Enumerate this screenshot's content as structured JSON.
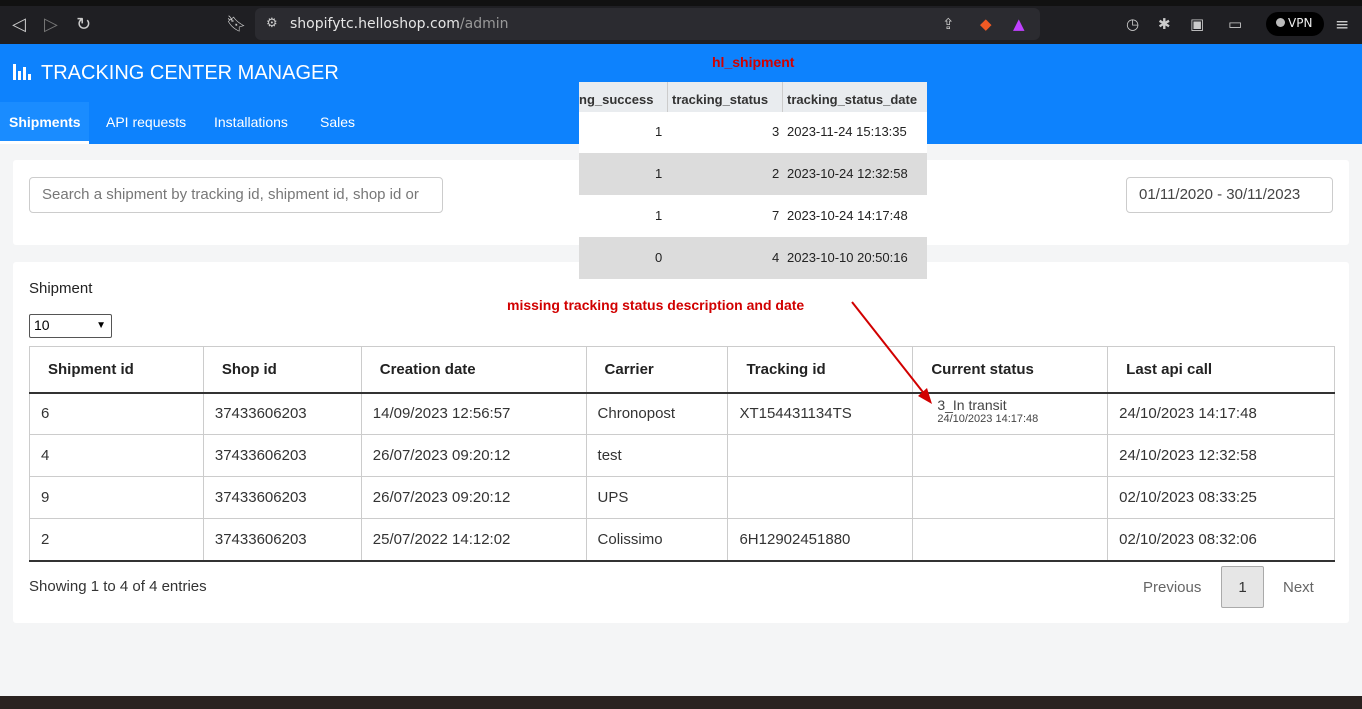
{
  "browser": {
    "url_host": "shopifytc.helloshop.com",
    "url_path": "/admin",
    "vpn_label": "VPN"
  },
  "app": {
    "title": "TRACKING CENTER MANAGER",
    "tabs": [
      {
        "label": "Shipments",
        "active": true
      },
      {
        "label": "API requests",
        "active": false
      },
      {
        "label": "Installations",
        "active": false
      },
      {
        "label": "Sales",
        "active": false
      }
    ]
  },
  "filters": {
    "search_placeholder": "Search a shipment by tracking id, shipment id, shop id or",
    "date_range": "01/11/2020 - 30/11/2023"
  },
  "list": {
    "title": "Shipment",
    "page_size": "10",
    "columns": [
      "Shipment id",
      "Shop id",
      "Creation date",
      "Carrier",
      "Tracking id",
      "Current status",
      "Last api call"
    ],
    "rows": [
      {
        "shipment_id": "6",
        "shop_id": "37433606203",
        "creation_date": "14/09/2023 12:56:57",
        "carrier": "Chronopost",
        "tracking_id": "XT154431134TS",
        "status": "3_In transit",
        "status_date": "24/10/2023 14:17:48",
        "last_api_call": "24/10/2023 14:17:48"
      },
      {
        "shipment_id": "4",
        "shop_id": "37433606203",
        "creation_date": "26/07/2023 09:20:12",
        "carrier": "test",
        "tracking_id": "",
        "status": "",
        "status_date": "",
        "last_api_call": "24/10/2023 12:32:58"
      },
      {
        "shipment_id": "9",
        "shop_id": "37433606203",
        "creation_date": "26/07/2023 09:20:12",
        "carrier": "UPS",
        "tracking_id": "",
        "status": "",
        "status_date": "",
        "last_api_call": "02/10/2023 08:33:25"
      },
      {
        "shipment_id": "2",
        "shop_id": "37433606203",
        "creation_date": "25/07/2022 14:12:02",
        "carrier": "Colissimo",
        "tracking_id": "6H12902451880",
        "status": "",
        "status_date": "",
        "last_api_call": "02/10/2023 08:32:06"
      }
    ],
    "entries_info": "Showing 1 to 4 of 4 entries",
    "pagination": {
      "previous": "Previous",
      "current": "1",
      "next": "Next"
    }
  },
  "db_overlay": {
    "title": "hl_shipment",
    "columns": [
      "ng_success",
      "tracking_status",
      "tracking_status_date"
    ],
    "rows": [
      [
        "1",
        "3",
        "2023-11-24 15:13:35"
      ],
      [
        "1",
        "2",
        "2023-10-24 12:32:58"
      ],
      [
        "1",
        "7",
        "2023-10-24 14:17:48"
      ],
      [
        "0",
        "4",
        "2023-10-10 20:50:16"
      ]
    ]
  },
  "annotation": "missing tracking status description and date",
  "colors": {
    "brand_blue": "#0d82fd",
    "annotation_red": "#d10000"
  }
}
